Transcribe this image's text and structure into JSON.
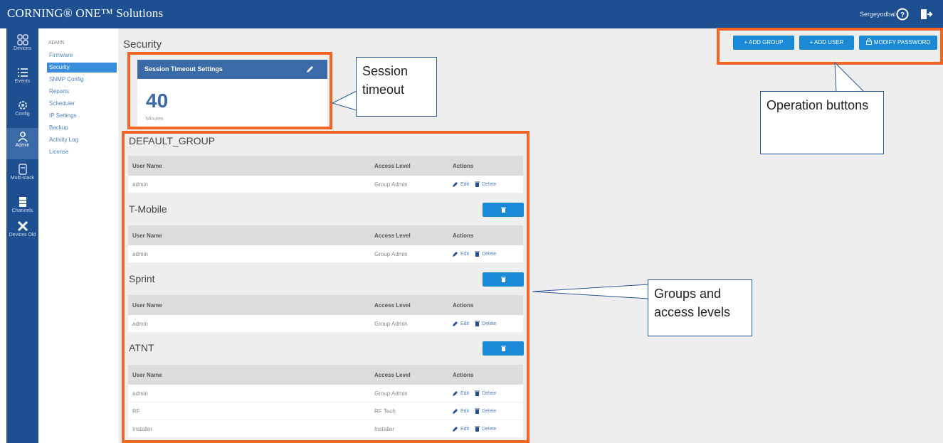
{
  "app": {
    "title": "CORNING® ONE™ Solutions",
    "username": "Sergeyodbal"
  },
  "nav": {
    "items": [
      {
        "label": "Devices",
        "icon": "devices-icon"
      },
      {
        "label": "Events",
        "icon": "list-icon"
      },
      {
        "label": "Config",
        "icon": "gear-icon"
      },
      {
        "label": "Admin",
        "icon": "user-icon"
      },
      {
        "label": "Multi-stack",
        "icon": "stack-icon"
      },
      {
        "label": "Channels",
        "icon": "channels-icon"
      },
      {
        "label": "Devices Old",
        "icon": "tools-icon"
      }
    ],
    "active": "Admin"
  },
  "submenu": {
    "header": "ADMIN",
    "items": [
      "Firmware",
      "Security",
      "SNMP Config",
      "Reports",
      "Scheduler",
      "IP Settings",
      "Backup",
      "Activity Log",
      "License"
    ],
    "active": "Security"
  },
  "page": {
    "title": "Security"
  },
  "buttons": {
    "add_group": "+ ADD GROUP",
    "add_user": "+ ADD USER",
    "modify_password": "MODIFY PASSWORD"
  },
  "session": {
    "title": "Session Timeout Settings",
    "value": "40",
    "unit": "Minutes"
  },
  "table_headers": {
    "user_name": "User Name",
    "access_level": "Access Level",
    "actions": "Actions"
  },
  "actions": {
    "edit": "Edit",
    "delete": "Delete"
  },
  "groups": [
    {
      "name": "DEFAULT_GROUP",
      "rows": [
        {
          "user": "admin",
          "level": "Group Admin"
        }
      ]
    },
    {
      "name": "T-Mobile",
      "rows": [
        {
          "user": "admin",
          "level": "Group Admin"
        }
      ]
    },
    {
      "name": "Sprint",
      "rows": [
        {
          "user": "admin",
          "level": "Group Admin"
        }
      ]
    },
    {
      "name": "ATNT",
      "rows": [
        {
          "user": "admin",
          "level": "Group Admin"
        },
        {
          "user": "RF",
          "level": "RF Tech"
        },
        {
          "user": "Installer",
          "level": "Installer"
        }
      ]
    }
  ],
  "callouts": {
    "session": "Session timeout",
    "operations": "Operation buttons",
    "groups": "Groups and access levels"
  },
  "colors": {
    "brand": "#1d4f91",
    "button": "#1a8ad6",
    "highlight": "#f26522"
  }
}
